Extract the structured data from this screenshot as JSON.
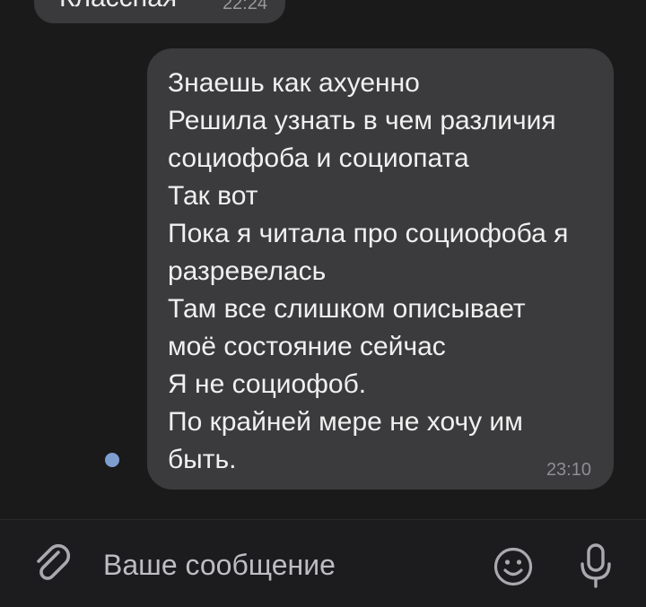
{
  "messages": [
    {
      "text": "Классная",
      "time": "22:24"
    },
    {
      "lines": [
        "Знаешь как ахуенно",
        "Решила узнать в чем различия",
        "социофоба и социопата",
        "Так вот",
        "Пока я читала про социофоба я",
        "разревелась",
        "Там все слишком описывает",
        "моё состояние сейчас",
        "Я не социофоб.",
        "По крайней мере не хочу им",
        "быть."
      ],
      "time": "23:10"
    }
  ],
  "composer": {
    "placeholder": "Ваше сообщение",
    "icons": [
      "paperclip-icon",
      "emoji-icon",
      "microphone-icon"
    ]
  },
  "colors": {
    "background": "#1a1a1a",
    "bubble": "#3b3b3d",
    "unread_dot": "#7e9ed0"
  }
}
